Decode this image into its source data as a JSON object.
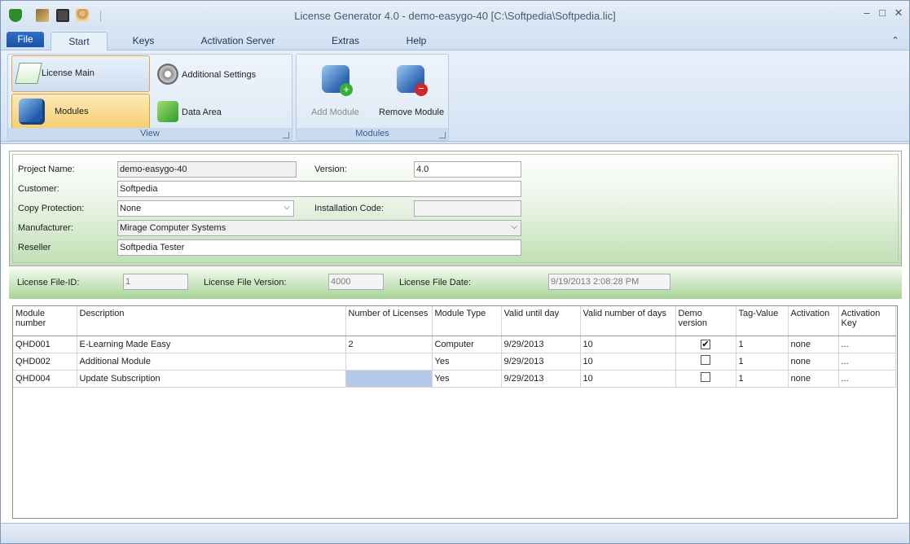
{
  "window": {
    "title": "License Generator 4.0  - demo-easygo-40 [C:\\Softpedia\\Softpedia.lic]",
    "quick_access": [
      "shield-icon",
      "wand-icon",
      "save-icon",
      "user-icon"
    ],
    "controls": {
      "minimize": "–",
      "maximize": "□",
      "close": "✕"
    }
  },
  "ribbon": {
    "tabs": [
      "File",
      "Start",
      "Keys",
      "Activation Server",
      "Extras",
      "Help"
    ],
    "active_tab": "Start",
    "collapse_glyph": "⌃",
    "groups": {
      "view": {
        "label": "View",
        "buttons": {
          "license_main": "License Main",
          "additional_settings": "Additional Settings",
          "modules": "Modules",
          "data_area": "Data Area"
        }
      },
      "modules": {
        "label": "Modules",
        "buttons": {
          "add_module": "Add Module",
          "remove_module": "Remove Module"
        }
      }
    }
  },
  "project": {
    "project_name_label": "Project Name:",
    "project_name": "demo-easygo-40",
    "version_label": "Version:",
    "version": "4.0",
    "customer_label": "Customer:",
    "customer": "Softpedia",
    "copy_protection_label": "Copy Protection:",
    "copy_protection": "None",
    "installation_code_label": "Installation Code:",
    "installation_code": "",
    "manufacturer_label": "Manufacturer:",
    "manufacturer": "Mirage Computer Systems",
    "reseller_label": "Reseller",
    "reseller": "Softpedia Tester"
  },
  "license_file": {
    "id_label": "License File-ID:",
    "id": "1",
    "version_label": "License File Version:",
    "version": "4000",
    "date_label": "License File Date:",
    "date": "9/19/2013 2:08:28 PM"
  },
  "modules_table": {
    "columns": [
      "Module number",
      "Description",
      "Number of Licenses",
      "Module Type",
      "Valid until day",
      "Valid number of days",
      "Demo version",
      "Tag-Value",
      "Activation",
      "Activation Key"
    ],
    "rows": [
      {
        "number": "QHD001",
        "description": "E-Learning Made Easy",
        "licenses": "2",
        "type": "Computer",
        "valid_until": "9/29/2013",
        "valid_days": "10",
        "demo": "✔",
        "tag": "1",
        "activation": "none",
        "key": "..."
      },
      {
        "number": "QHD002",
        "description": "Additional Module",
        "licenses": "",
        "type": "Yes",
        "valid_until": "9/29/2013",
        "valid_days": "10",
        "demo": "",
        "tag": "1",
        "activation": "none",
        "key": "..."
      },
      {
        "number": "QHD004",
        "description": "Update Subscription",
        "licenses": "",
        "type": "Yes",
        "valid_until": "9/29/2013",
        "valid_days": "10",
        "demo": "",
        "tag": "1",
        "activation": "none",
        "key": "..."
      }
    ]
  },
  "colors": {
    "accent": "#1c52a4",
    "ribbon": "#d4e2f3",
    "panel_green": "#bfe0b4",
    "selection": "#b7c9ea"
  }
}
